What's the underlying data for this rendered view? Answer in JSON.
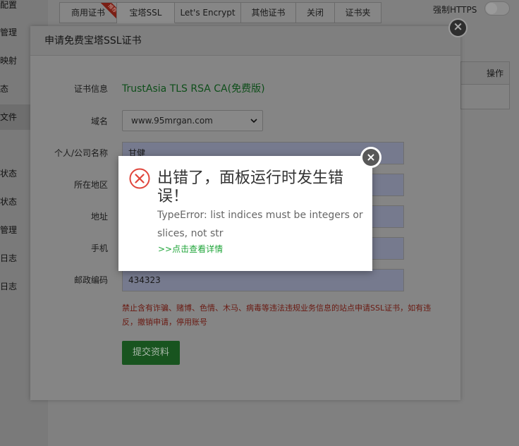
{
  "sidebar": {
    "items": [
      "配置",
      "管理",
      "映射",
      "态",
      "文件",
      "状态",
      "状态",
      "管理",
      "日志",
      "日志"
    ]
  },
  "tabs": [
    {
      "label": "商用证书",
      "badge": "推荐"
    },
    {
      "label": "宝塔SSL"
    },
    {
      "label": "Let's Encrypt"
    },
    {
      "label": "其他证书"
    },
    {
      "label": "关闭"
    },
    {
      "label": "证书夹"
    }
  ],
  "https": {
    "label": "强制HTTPS"
  },
  "table": {
    "action_header": "操作"
  },
  "ssl_modal": {
    "title": "申请免费宝塔SSL证书",
    "close_icon": "×",
    "fields": {
      "cert_info": {
        "label": "证书信息",
        "value": "TrustAsia TLS RSA CA(免费版)"
      },
      "domain": {
        "label": "域名",
        "value": "www.95mrgan.com"
      },
      "owner": {
        "label": "个人/公司名称",
        "value": "甘健"
      },
      "region": {
        "label": "所在地区",
        "value": ""
      },
      "address": {
        "label": "地址",
        "value": ""
      },
      "phone": {
        "label": "手机",
        "value": ""
      },
      "zip": {
        "label": "邮政编码",
        "value": "434323"
      }
    },
    "warning": "禁止含有诈骗、赌博、色情、木马、病毒等违法违规业务信息的站点申请SSL证书，如有违反，撤销申请，停用账号",
    "submit_label": "提交资料"
  },
  "error_dialog": {
    "title": "出错了，面板运行时发生错误！",
    "message": "TypeError: list indices must be integers or slices, not str",
    "link": ">>点击查看详情",
    "close_icon": "×",
    "colors": {
      "icon": "#e0463c",
      "link": "#20a53a"
    }
  }
}
